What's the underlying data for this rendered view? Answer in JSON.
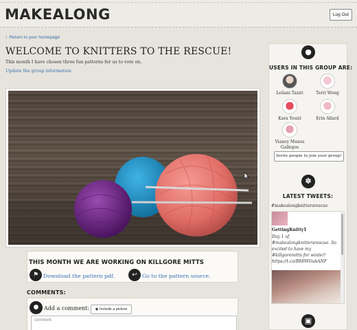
{
  "header": {
    "logo": "MAKEALONG",
    "logout_label": "Log Out"
  },
  "nav": {
    "back_link": "Return to your homepage",
    "back_icon": "chevron-left-icon"
  },
  "main": {
    "title": "WELCOME TO KNITTERS TO THE RESCUE!",
    "intro": "This month I have chosen three fun patterns for us to vote on.",
    "update_link": "Update the group information"
  },
  "project": {
    "heading": "THIS MONTH WE ARE WORKING ON KILLGORE MITTS",
    "download_label": "Download the pattern pdf.",
    "download_icon": "bookmark-icon",
    "source_label": "Go to the pattern source.",
    "source_icon": "arrow-left-circle-icon"
  },
  "comments": {
    "heading": "COMMENTS:",
    "add_label": "Add a comment:",
    "include_picture_label": "Include a picture",
    "placeholder": "comment",
    "icon": "speech-bubble-icon"
  },
  "sidebar": {
    "users_icon": "user-icon",
    "users_heading": "USERS IN THIS GROUP ARE:",
    "members": [
      {
        "name": "Leilani Taziri"
      },
      {
        "name": "Terri Wong"
      },
      {
        "name": "Kara Yount"
      },
      {
        "name": "Erin Allard"
      },
      {
        "name": "Vianey Munoz Gallegos"
      }
    ],
    "invite_label": "Invite people to join your group!",
    "twitter_icon": "twitter-icon",
    "tweets_heading": "LATEST TWEETS:",
    "hashtag": "#makealongknittersrescue",
    "tweet": {
      "author": "GettingKnitty1",
      "text": "Day 1 of #makealongknittersrescue. So excited to have my #killgoremitts for winter! https://t.co/BMlWOubANF"
    },
    "gallery_icon": "image-icon"
  },
  "colors": {
    "accent_link": "#3b6fb0",
    "background": "#e6e4dd",
    "yarn_pink": "#e8766f",
    "yarn_blue": "#1f9ad1",
    "yarn_purple": "#7a2d8f"
  }
}
